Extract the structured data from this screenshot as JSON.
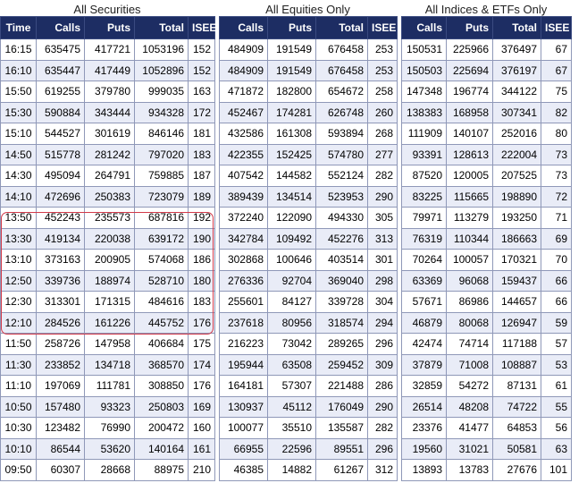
{
  "panels": [
    {
      "title": "All Securities",
      "headers": [
        "Time",
        "Calls",
        "Puts",
        "Total",
        "ISEE"
      ],
      "rows": [
        [
          "16:15",
          "635475",
          "417721",
          "1053196",
          "152"
        ],
        [
          "16:10",
          "635447",
          "417449",
          "1052896",
          "152"
        ],
        [
          "15:50",
          "619255",
          "379780",
          "999035",
          "163"
        ],
        [
          "15:30",
          "590884",
          "343444",
          "934328",
          "172"
        ],
        [
          "15:10",
          "544527",
          "301619",
          "846146",
          "181"
        ],
        [
          "14:50",
          "515778",
          "281242",
          "797020",
          "183"
        ],
        [
          "14:30",
          "495094",
          "264791",
          "759885",
          "187"
        ],
        [
          "14:10",
          "472696",
          "250383",
          "723079",
          "189"
        ],
        [
          "13:50",
          "452243",
          "235573",
          "687816",
          "192"
        ],
        [
          "13:30",
          "419134",
          "220038",
          "639172",
          "190"
        ],
        [
          "13:10",
          "373163",
          "200905",
          "574068",
          "186"
        ],
        [
          "12:50",
          "339736",
          "188974",
          "528710",
          "180"
        ],
        [
          "12:30",
          "313301",
          "171315",
          "484616",
          "183"
        ],
        [
          "12:10",
          "284526",
          "161226",
          "445752",
          "176"
        ],
        [
          "11:50",
          "258726",
          "147958",
          "406684",
          "175"
        ],
        [
          "11:30",
          "233852",
          "134718",
          "368570",
          "174"
        ],
        [
          "11:10",
          "197069",
          "111781",
          "308850",
          "176"
        ],
        [
          "10:50",
          "157480",
          "93323",
          "250803",
          "169"
        ],
        [
          "10:30",
          "123482",
          "76990",
          "200472",
          "160"
        ],
        [
          "10:10",
          "86544",
          "53620",
          "140164",
          "161"
        ],
        [
          "09:50",
          "60307",
          "28668",
          "88975",
          "210"
        ]
      ]
    },
    {
      "title": "All Equities Only",
      "headers": [
        "Calls",
        "Puts",
        "Total",
        "ISEE"
      ],
      "rows": [
        [
          "484909",
          "191549",
          "676458",
          "253"
        ],
        [
          "484909",
          "191549",
          "676458",
          "253"
        ],
        [
          "471872",
          "182800",
          "654672",
          "258"
        ],
        [
          "452467",
          "174281",
          "626748",
          "260"
        ],
        [
          "432586",
          "161308",
          "593894",
          "268"
        ],
        [
          "422355",
          "152425",
          "574780",
          "277"
        ],
        [
          "407542",
          "144582",
          "552124",
          "282"
        ],
        [
          "389439",
          "134514",
          "523953",
          "290"
        ],
        [
          "372240",
          "122090",
          "494330",
          "305"
        ],
        [
          "342784",
          "109492",
          "452276",
          "313"
        ],
        [
          "302868",
          "100646",
          "403514",
          "301"
        ],
        [
          "276336",
          "92704",
          "369040",
          "298"
        ],
        [
          "255601",
          "84127",
          "339728",
          "304"
        ],
        [
          "237618",
          "80956",
          "318574",
          "294"
        ],
        [
          "216223",
          "73042",
          "289265",
          "296"
        ],
        [
          "195944",
          "63508",
          "259452",
          "309"
        ],
        [
          "164181",
          "57307",
          "221488",
          "286"
        ],
        [
          "130937",
          "45112",
          "176049",
          "290"
        ],
        [
          "100077",
          "35510",
          "135587",
          "282"
        ],
        [
          "66955",
          "22596",
          "89551",
          "296"
        ],
        [
          "46385",
          "14882",
          "61267",
          "312"
        ]
      ]
    },
    {
      "title": "All Indices & ETFs Only",
      "headers": [
        "Calls",
        "Puts",
        "Total",
        "ISEE"
      ],
      "rows": [
        [
          "150531",
          "225966",
          "376497",
          "67"
        ],
        [
          "150503",
          "225694",
          "376197",
          "67"
        ],
        [
          "147348",
          "196774",
          "344122",
          "75"
        ],
        [
          "138383",
          "168958",
          "307341",
          "82"
        ],
        [
          "111909",
          "140107",
          "252016",
          "80"
        ],
        [
          "93391",
          "128613",
          "222004",
          "73"
        ],
        [
          "87520",
          "120005",
          "207525",
          "73"
        ],
        [
          "83225",
          "115665",
          "198890",
          "72"
        ],
        [
          "79971",
          "113279",
          "193250",
          "71"
        ],
        [
          "76319",
          "110344",
          "186663",
          "69"
        ],
        [
          "70264",
          "100057",
          "170321",
          "70"
        ],
        [
          "63369",
          "96068",
          "159437",
          "66"
        ],
        [
          "57671",
          "86986",
          "144657",
          "66"
        ],
        [
          "46879",
          "80068",
          "126947",
          "59"
        ],
        [
          "42474",
          "74714",
          "117188",
          "57"
        ],
        [
          "37879",
          "71008",
          "108887",
          "53"
        ],
        [
          "32859",
          "54272",
          "87131",
          "61"
        ],
        [
          "26514",
          "48208",
          "74722",
          "55"
        ],
        [
          "23376",
          "41477",
          "64853",
          "56"
        ],
        [
          "19560",
          "31021",
          "50581",
          "63"
        ],
        [
          "13893",
          "13783",
          "27676",
          "101"
        ]
      ]
    }
  ],
  "colors": {
    "header_bg": "#1d2d63",
    "alt_row_bg": "#e9ecf7",
    "highlight_border": "#d23a4a"
  }
}
